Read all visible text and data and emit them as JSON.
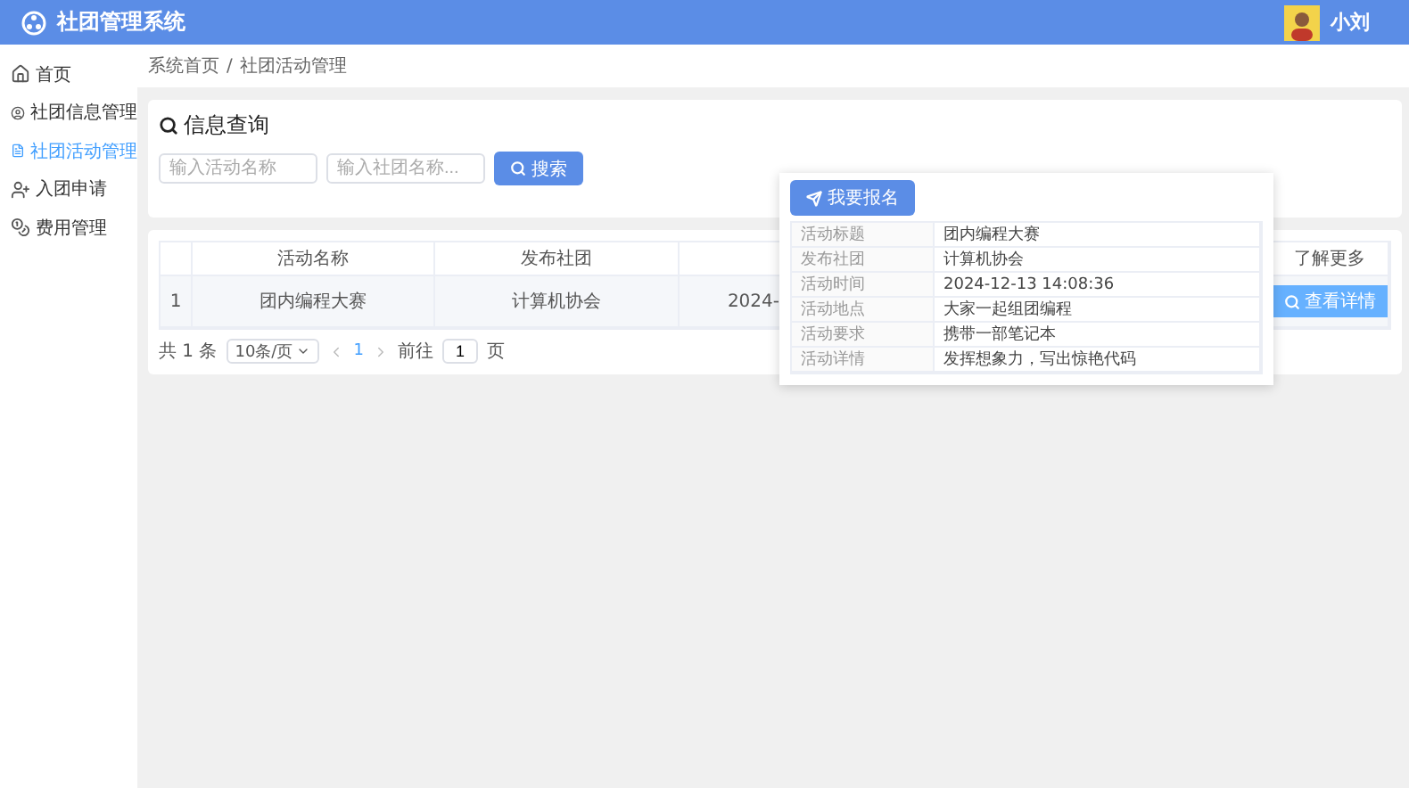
{
  "header": {
    "title": "社团管理系统",
    "user": "小刘"
  },
  "sidebar": {
    "items": [
      {
        "label": "首页",
        "selected": false
      },
      {
        "label": "社团信息管理",
        "selected": false
      },
      {
        "label": "社团活动管理",
        "selected": true
      },
      {
        "label": "入团申请",
        "selected": false
      },
      {
        "label": "费用管理",
        "selected": false
      }
    ]
  },
  "breadcrumb": {
    "items": [
      "系统首页",
      "社团活动管理"
    ],
    "separator": "/"
  },
  "query": {
    "title": "信息查询",
    "fields": [
      {
        "placeholder": "输入活动名称"
      },
      {
        "placeholder": "输入社团名称..."
      }
    ],
    "search_button": "搜索"
  },
  "table": {
    "columns": [
      "活动名称",
      "发布社团",
      "了解更多"
    ],
    "rows": [
      {
        "index": "1",
        "name": "团内编程大赛",
        "club": "计算机协会",
        "time": "2024-",
        "action": "查看详情"
      }
    ]
  },
  "pagination": {
    "total": "共 1 条",
    "page_size": "10条/页",
    "current": "1",
    "goto_label": "前往",
    "goto_value": "1",
    "page_unit": "页"
  },
  "popover": {
    "button": "我要报名",
    "fields": [
      {
        "label": "活动标题",
        "value": "团内编程大赛"
      },
      {
        "label": "发布社团",
        "value": "计算机协会"
      },
      {
        "label": "活动时间",
        "value": "2024-12-13 14:08:36"
      },
      {
        "label": "活动地点",
        "value": "大家一起组团编程"
      },
      {
        "label": "活动要求",
        "value": "携带一部笔记本"
      },
      {
        "label": "活动详情",
        "value": "发挥想象力，写出惊艳代码"
      }
    ]
  }
}
